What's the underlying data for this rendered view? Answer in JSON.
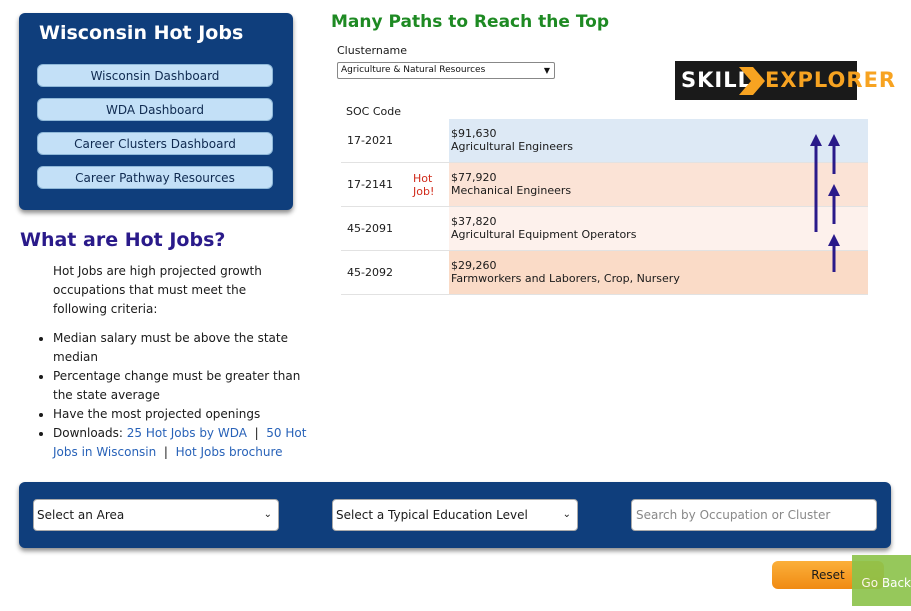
{
  "hot_panel": {
    "title": "Wisconsin Hot Jobs",
    "buttons": [
      "Wisconsin Dashboard",
      "WDA Dashboard",
      "Career Clusters Dashboard",
      "Career Pathway Resources"
    ]
  },
  "what_are": {
    "title": "What are Hot Jobs?",
    "intro": "Hot Jobs are high projected growth occupations that must meet the following criteria:",
    "criteria": [
      "Median salary must be above the state median",
      "Percentage change must be greater than the state average",
      "Have the most projected openings"
    ],
    "downloads_label": "Downloads:",
    "download_links": [
      "25 Hot Jobs by WDA",
      "50 Hot Jobs in Wisconsin",
      "Hot Jobs brochure"
    ],
    "separator": "|"
  },
  "paths": {
    "title": "Many Paths to Reach the Top",
    "cluster_label": "Clustername",
    "cluster_value": "Agriculture & Natural Resources",
    "logo_word1": "SKILL",
    "logo_word2": "EXPLORER",
    "soc_header": "SOC Code",
    "hot_label_line1": "Hot",
    "hot_label_line2": "Job!",
    "rows": [
      {
        "code": "17-2021",
        "salary": "$91,630",
        "title": "Agricultural Engineers",
        "hot": false,
        "bg": "#dde9f5"
      },
      {
        "code": "17-2141",
        "salary": "$77,920",
        "title": "Mechanical Engineers",
        "hot": true,
        "bg": "#fbe3d6"
      },
      {
        "code": "45-2091",
        "salary": "$37,820",
        "title": "Agricultural Equipment Operators",
        "hot": false,
        "bg": "#fdf1ec"
      },
      {
        "code": "45-2092",
        "salary": "$29,260",
        "title": "Farmworkers and Laborers, Crop, Nursery",
        "hot": false,
        "bg": "#fadbc7"
      }
    ]
  },
  "search": {
    "area_select": "Select an Area",
    "education_select": "Select a Typical Education Level",
    "occupation_placeholder": "Search by Occupation or Cluster"
  },
  "reset_label": "Reset",
  "go_back_label": "Go Back",
  "colors": {
    "panel_bg": "#0f3e7c",
    "title_green": "#1e8a23",
    "hot_red": "#d12a1a",
    "arrow": "#2a1a8a",
    "link": "#2862b8"
  }
}
